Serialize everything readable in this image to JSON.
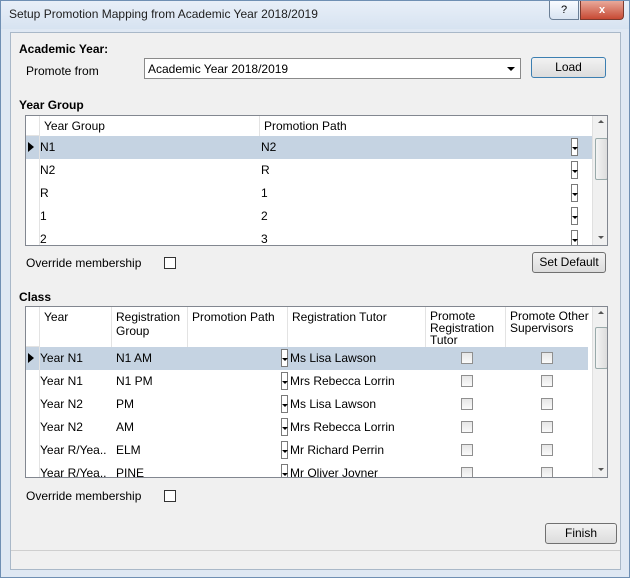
{
  "window": {
    "title": "Setup Promotion Mapping from Academic Year 2018/2019",
    "help_glyph": "?",
    "close_glyph": "x"
  },
  "academic": {
    "heading": "Academic Year:",
    "promote_from_label": "Promote from",
    "select_value": "Academic Year 2018/2019",
    "load_label": "Load"
  },
  "year_group": {
    "heading": "Year Group",
    "columns": [
      "Year Group",
      "Promotion Path"
    ],
    "rows": [
      {
        "group": "N1",
        "path": "N2",
        "selected": true
      },
      {
        "group": "N2",
        "path": "R",
        "selected": false
      },
      {
        "group": "R",
        "path": "1",
        "selected": false
      },
      {
        "group": "1",
        "path": "2",
        "selected": false
      },
      {
        "group": "2",
        "path": "3",
        "selected": false
      }
    ],
    "override_label": "Override membership",
    "set_default_label": "Set Default"
  },
  "class": {
    "heading": "Class",
    "columns": [
      "Year",
      "Registration Group",
      "Promotion Path",
      "Registration Tutor",
      "Promote Registration Tutor",
      "Promote Other Supervisors"
    ],
    "rows": [
      {
        "year": "Year N1",
        "group": "N1 AM",
        "path": "",
        "tutor": "Ms Lisa Lawson",
        "selected": true
      },
      {
        "year": "Year N1",
        "group": "N1 PM",
        "path": "",
        "tutor": "Mrs Rebecca Lorrin",
        "selected": false
      },
      {
        "year": "Year  N2",
        "group": "PM",
        "path": "",
        "tutor": "Ms Lisa Lawson",
        "selected": false
      },
      {
        "year": "Year  N2",
        "group": "AM",
        "path": "",
        "tutor": "Mrs Rebecca Lorrin",
        "selected": false
      },
      {
        "year": "Year  R/Yea..",
        "group": "ELM",
        "path": "",
        "tutor": "Mr Richard Perrin",
        "selected": false
      },
      {
        "year": "Year  R/Yea..",
        "group": "PINE",
        "path": "",
        "tutor": "Mr Oliver Joyner",
        "selected": false
      }
    ],
    "override_label": "Override membership"
  },
  "finish_label": "Finish"
}
